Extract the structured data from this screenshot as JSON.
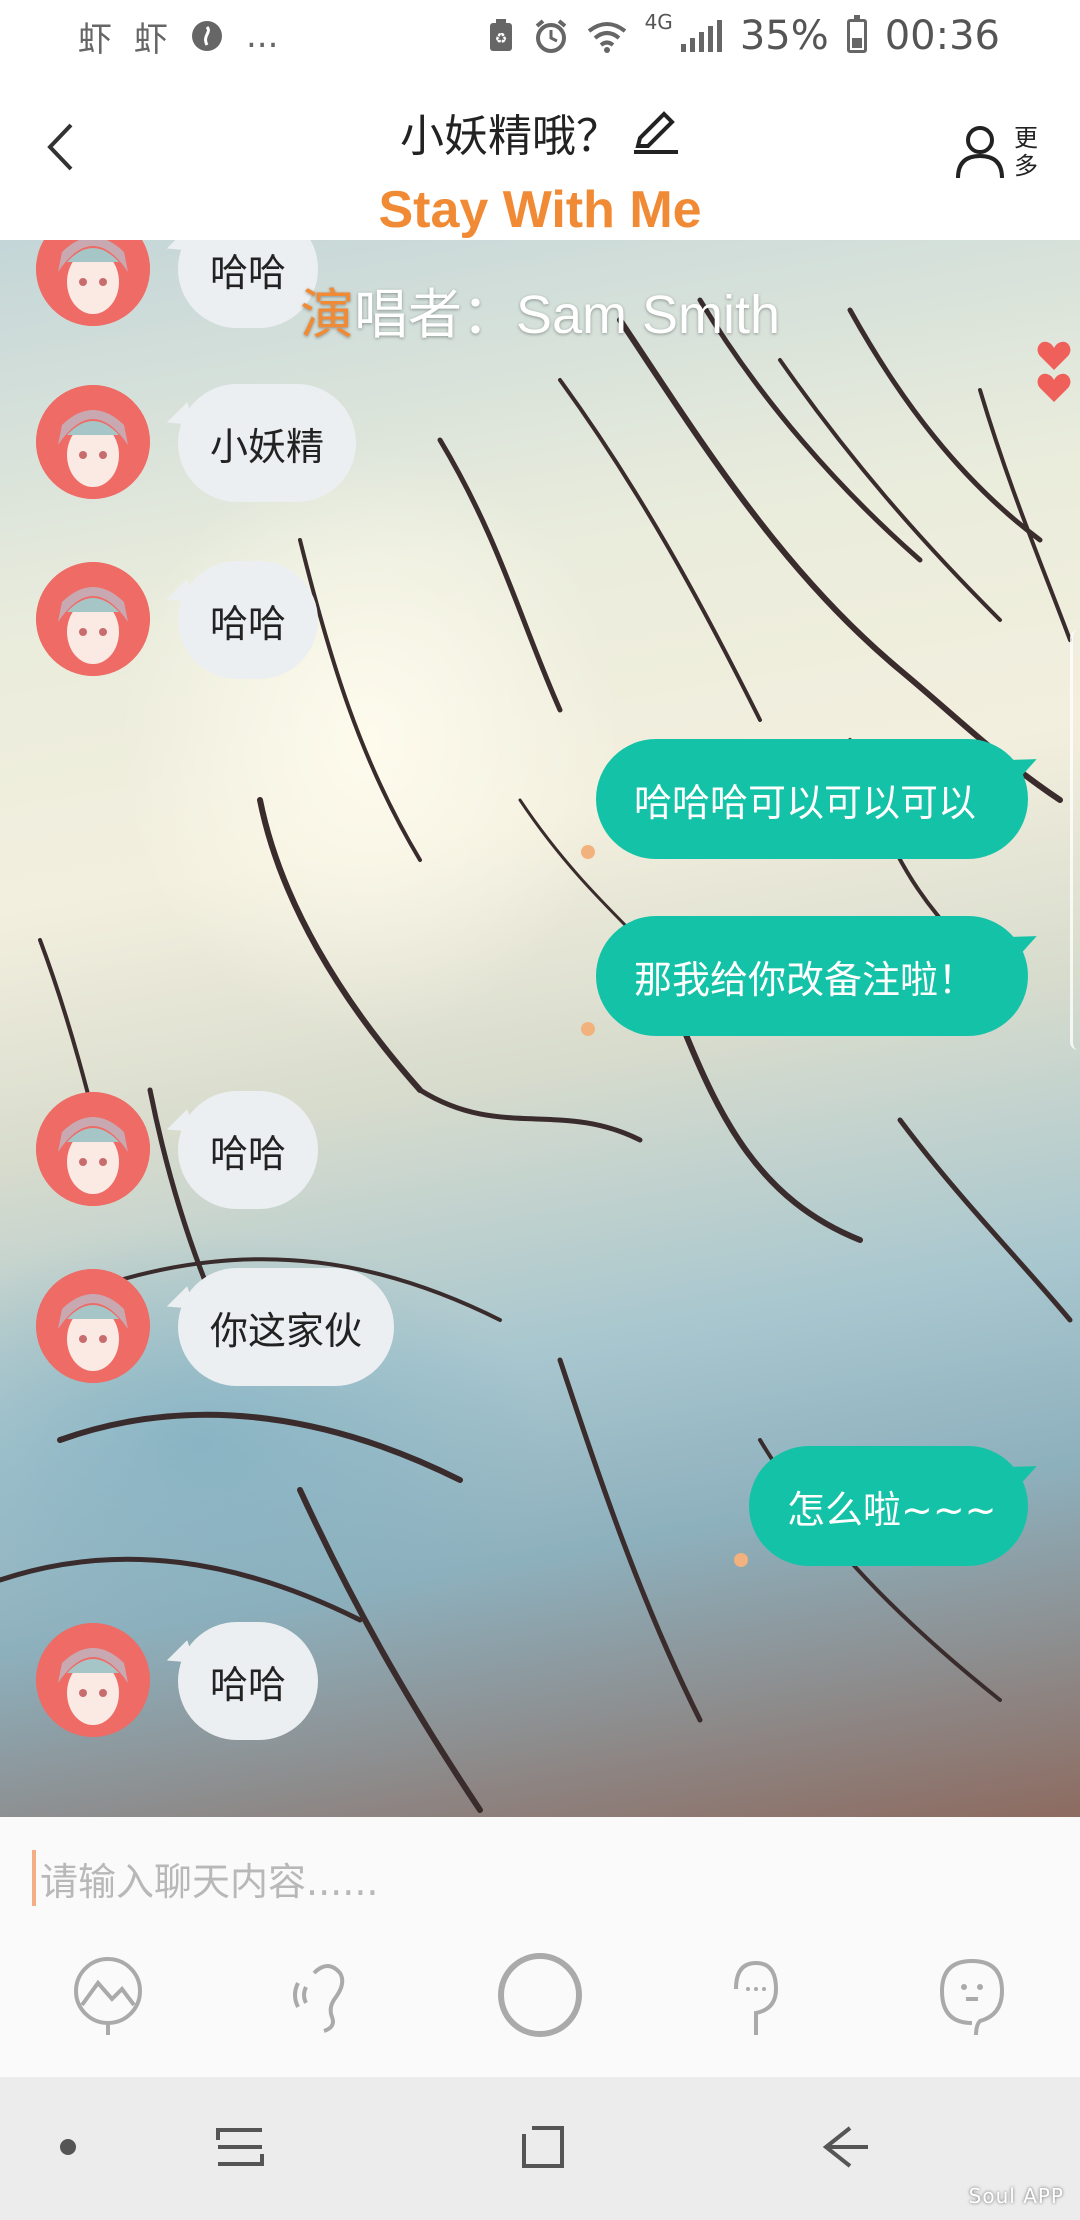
{
  "status_bar": {
    "app_icon_1": "虾",
    "app_icon_2": "虾",
    "more": "...",
    "network": "4G",
    "battery": "35%",
    "time": "00:36"
  },
  "header": {
    "title": "小妖精哦？",
    "more_label": "更多",
    "song_title": "Stay With Me"
  },
  "singer": {
    "first_char": "演",
    "rest": "唱者：Sam Smith"
  },
  "messages": [
    {
      "from": "them",
      "text": "哈哈"
    },
    {
      "from": "them",
      "text": "小妖精"
    },
    {
      "from": "them",
      "text": "哈哈"
    },
    {
      "from": "me",
      "text": "哈哈哈可以可以可以"
    },
    {
      "from": "me",
      "text": "那我给你改备注啦！"
    },
    {
      "from": "them",
      "text": "哈哈"
    },
    {
      "from": "them",
      "text": "你这家伙"
    },
    {
      "from": "me",
      "text": "怎么啦~~~"
    },
    {
      "from": "them",
      "text": "哈哈"
    }
  ],
  "input": {
    "placeholder": "请输入聊天内容......"
  },
  "watermark": "Soul APP",
  "colors": {
    "accent": "#14c3a7",
    "incoming_bubble": "#eceff1",
    "song_title": "#f08a35",
    "avatar": "#ee6b66"
  },
  "icons": {
    "toolbar": [
      "image-icon",
      "voice-icon",
      "circle-icon",
      "mic-icon",
      "emoji-icon"
    ],
    "nav": [
      "dot-icon",
      "recent-apps-icon",
      "home-icon",
      "back-icon"
    ]
  }
}
